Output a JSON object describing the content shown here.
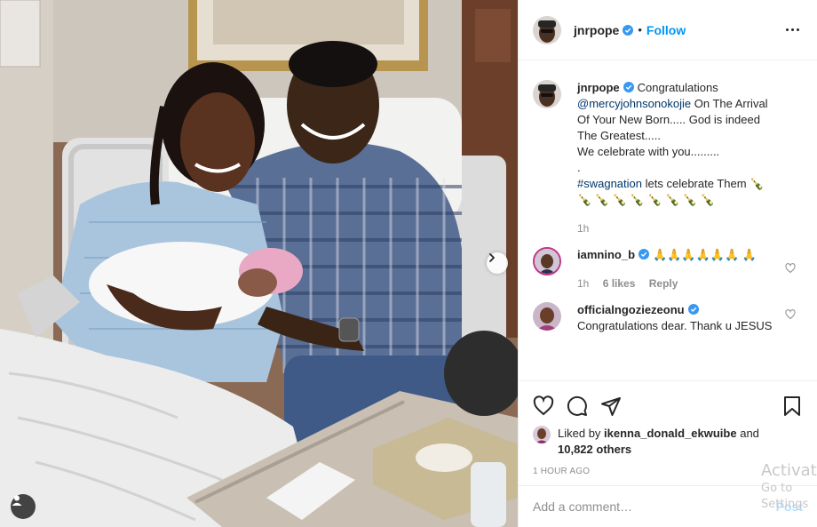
{
  "post": {
    "username": "jnrpope",
    "follow_label": "Follow",
    "separator": "•",
    "caption": {
      "username": "jnrpope",
      "line1": "Congratulations",
      "mention": "@mercyjohnsonokojie",
      "line2": "On The Arrival Of Your New Born..... God is indeed The Greatest.....",
      "line3": "We celebrate with you.........",
      "line4": ".",
      "hashtag": "#swagnation",
      "line5": "lets celebrate Them 🍾 🍾 🍾 🍾 🍾 🍾 🍾 🍾 🍾",
      "time": "1h"
    },
    "comments": [
      {
        "username": "iamnino_b",
        "text": "🙏🙏🙏🙏🙏🙏 🙏",
        "time": "1h",
        "likes": "6 likes",
        "reply": "Reply"
      },
      {
        "username": "officialngoziezeonu",
        "text": "Congratulations dear. Thank u JESUS"
      }
    ],
    "liked_by_prefix": "Liked by",
    "liked_by_user": "ikenna_donald_ekwuibe",
    "liked_by_and": "and",
    "liked_by_others": "10,822 others",
    "timestamp": "1 HOUR AGO",
    "add_comment_placeholder": "Add a comment…",
    "post_label": "Post"
  },
  "icons": [
    "verified-badge-icon",
    "more-options-icon",
    "heart-icon",
    "comment-icon",
    "share-icon",
    "save-icon",
    "chevron-right-icon",
    "user-tags-icon"
  ],
  "overlay": {
    "line1": "Activate",
    "line2": "Go to Settings"
  },
  "colors": {
    "accent": "#0095f6",
    "link": "#00376b",
    "muted": "#8e8e8e",
    "post_disabled": "#b2dffc"
  }
}
